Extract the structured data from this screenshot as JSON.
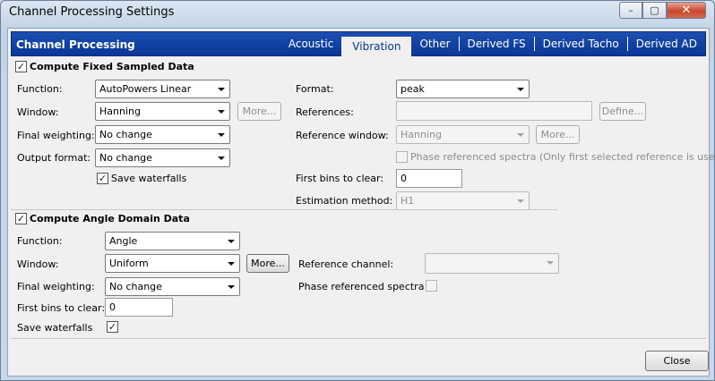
{
  "window": {
    "title": "Channel Processing Settings",
    "controls": {
      "minimize": "–",
      "maximize": "▢",
      "close": "✕"
    }
  },
  "header": {
    "title": "Channel Processing",
    "tabs": [
      "Acoustic",
      "Vibration",
      "Other",
      "Derived FS",
      "Derived Tacho",
      "Derived AD"
    ],
    "active_tab": "Vibration"
  },
  "fixed": {
    "title": "Compute Fixed Sampled Data",
    "checked": true,
    "function_label": "Function:",
    "function_value": "AutoPowers Linear",
    "window_label": "Window:",
    "window_value": "Hanning",
    "window_more": "More...",
    "weighting_label": "Final weighting:",
    "weighting_value": "No change",
    "output_label": "Output format:",
    "output_value": "No change",
    "save_waterfalls_label": "Save waterfalls",
    "save_waterfalls_checked": true,
    "format_label": "Format:",
    "format_value": "peak",
    "references_label": "References:",
    "references_value": "",
    "define_button": "Define...",
    "ref_window_label": "Reference window:",
    "ref_window_value": "Hanning",
    "ref_window_more": "More...",
    "phase_ref_label": "Phase referenced spectra (Only first selected reference is used)",
    "first_bins_label": "First bins to clear:",
    "first_bins_value": "0",
    "estimation_label": "Estimation method:",
    "estimation_value": "H1"
  },
  "angle": {
    "title": "Compute Angle Domain Data",
    "checked": true,
    "function_label": "Function:",
    "function_value": "Angle",
    "window_label": "Window:",
    "window_value": "Uniform",
    "window_more": "More...",
    "weighting_label": "Final weighting:",
    "weighting_value": "No change",
    "first_bins_label": "First bins to clear:",
    "first_bins_value": "0",
    "save_waterfalls_label": "Save waterfalls",
    "save_waterfalls_checked": true,
    "ref_channel_label": "Reference channel:",
    "ref_channel_value": "",
    "phase_ref_label": "Phase referenced spectra"
  },
  "footer": {
    "close_button": "Close"
  },
  "icons": {
    "check": "✓"
  }
}
